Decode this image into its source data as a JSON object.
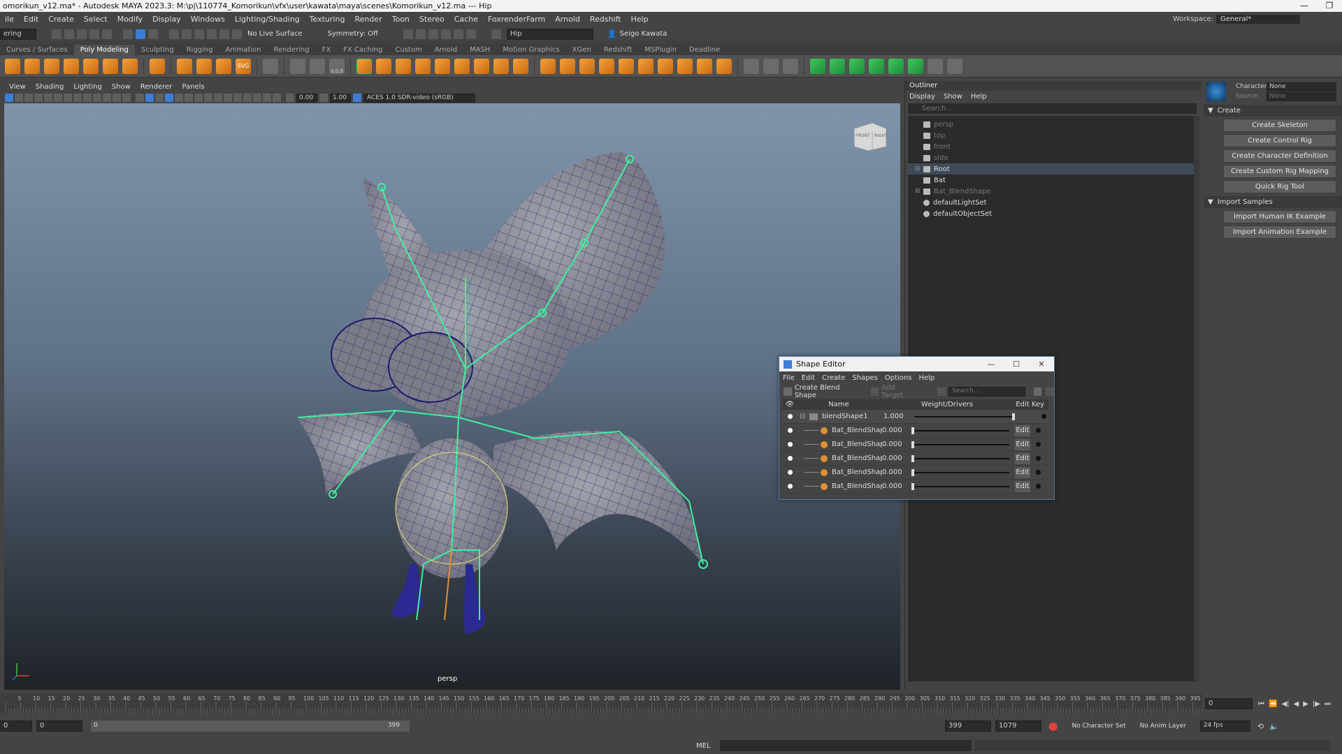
{
  "window": {
    "title": "omorikun_v12.ma* - Autodesk MAYA 2023.3: M:\\pj\\110774_Komorikun\\vfx\\user\\kawata\\maya\\scenes\\Komorikun_v12.ma  ---  Hip",
    "minimize": "—",
    "maximize": "❐"
  },
  "menubar": {
    "items": [
      "ile",
      "Edit",
      "Create",
      "Select",
      "Modify",
      "Display",
      "Windows",
      "Lighting/Shading",
      "Texturing",
      "Render",
      "Toon",
      "Stereo",
      "Cache",
      "FoxrenderFarm",
      "Arnold",
      "Redshift",
      "Help"
    ],
    "workspace_label": "Workspace:",
    "workspace_value": "General*"
  },
  "statusline": {
    "mode": "ering",
    "live_surface": "No Live Surface",
    "symmetry": "Symmetry: Off",
    "search_value": "Hip",
    "user": "Seigo Kawata"
  },
  "shelf": {
    "tabs": [
      "Curves / Surfaces",
      "Poly Modeling",
      "Sculpting",
      "Rigging",
      "Animation",
      "Rendering",
      "FX",
      "FX Caching",
      "Custom",
      "Arnold",
      "MASH",
      "Motion Graphics",
      "XGen",
      "Redshift",
      "MSPlugin",
      "Deadline"
    ],
    "active_tab": "Poly Modeling",
    "svg_label": "SVG",
    "coords_label": "0,0,0"
  },
  "viewport": {
    "menus": [
      "View",
      "Shading",
      "Lighting",
      "Show",
      "Renderer",
      "Panels"
    ],
    "field_a": "0.00",
    "field_b": "1.00",
    "colorspace": "ACES 1.0 SDR-video (sRGB)",
    "camera_label": "persp",
    "viewcube_front": "FRONT",
    "viewcube_right": "RIGHT"
  },
  "outliner": {
    "title": "Outliner",
    "menus": [
      "Display",
      "Show",
      "Help"
    ],
    "search_placeholder": "Search...",
    "items": [
      {
        "label": "persp"
      },
      {
        "label": "top"
      },
      {
        "label": "front"
      },
      {
        "label": "side"
      },
      {
        "label": "Root"
      },
      {
        "label": "Bat"
      },
      {
        "label": "Bat_BlendShape"
      },
      {
        "label": "defaultLightSet"
      },
      {
        "label": "defaultObjectSet"
      }
    ]
  },
  "hik": {
    "character_label": "Character:",
    "character_value": "None",
    "source_label": "Source:",
    "source_value": "None",
    "section_create": "Create",
    "buttons_create": [
      "Create Skeleton",
      "Create Control Rig",
      "Create Character Definition",
      "Create Custom Rig Mapping",
      "Quick Rig Tool"
    ],
    "section_import": "Import Samples",
    "buttons_import": [
      "Import Human IK Example",
      "Import Animation Example"
    ]
  },
  "shape_editor": {
    "title": "Shape Editor",
    "menus": [
      "File",
      "Edit",
      "Create",
      "Shapes",
      "Options",
      "Help"
    ],
    "create_blend_shape": "Create Blend Shape",
    "add_target": "Add Target",
    "search_placeholder": "Search...",
    "col_name": "Name",
    "col_weight": "Weight/Drivers",
    "col_edit": "Edit",
    "col_key": "Key",
    "edit_label": "Edit",
    "parent": {
      "name": "blendShape1",
      "value": "1.000",
      "fraction": 1.0
    },
    "targets": [
      {
        "name": "Bat_BlendShape",
        "value": "0.000",
        "fraction": 0.0
      },
      {
        "name": "Bat_BlendShape",
        "value": "0.000",
        "fraction": 0.0
      },
      {
        "name": "Bat_BlendShape",
        "value": "0.000",
        "fraction": 0.0
      },
      {
        "name": "Bat_BlendShape",
        "value": "0.000",
        "fraction": 0.0
      },
      {
        "name": "Bat_BlendShape",
        "value": "0.000",
        "fraction": 0.0
      }
    ]
  },
  "timeline": {
    "ticks": [
      "5",
      "10",
      "15",
      "20",
      "25",
      "30",
      "35",
      "40",
      "45",
      "50",
      "55",
      "60",
      "65",
      "70",
      "75",
      "80",
      "85",
      "90",
      "95",
      "100",
      "105",
      "110",
      "115",
      "120",
      "125",
      "130",
      "135",
      "140",
      "145",
      "150",
      "155",
      "160",
      "165",
      "170",
      "175",
      "180",
      "185",
      "190",
      "195",
      "200",
      "205",
      "210",
      "215",
      "220",
      "225",
      "230",
      "235",
      "240",
      "245",
      "250",
      "255",
      "260",
      "265",
      "270",
      "275",
      "280",
      "285",
      "290",
      "295",
      "300",
      "305",
      "310",
      "315",
      "320",
      "325",
      "330",
      "335",
      "340",
      "345",
      "350",
      "355",
      "360",
      "365",
      "370",
      "375",
      "380",
      "385",
      "390",
      "395"
    ],
    "current_frame": "0"
  },
  "range": {
    "start": "0",
    "range_start": "0",
    "range_end": "399",
    "end_a": "399",
    "end_b": "1079",
    "character_set": "No Character Set",
    "anim_layer": "No Anim Layer",
    "fps": "24 fps"
  },
  "cmdline": {
    "language": "MEL"
  },
  "colors": {
    "accent": "#3b7dd8",
    "rig_green": "#3ef0a0",
    "mesh_line": "#1a1a7a",
    "selected_row": "#3e4a58"
  }
}
